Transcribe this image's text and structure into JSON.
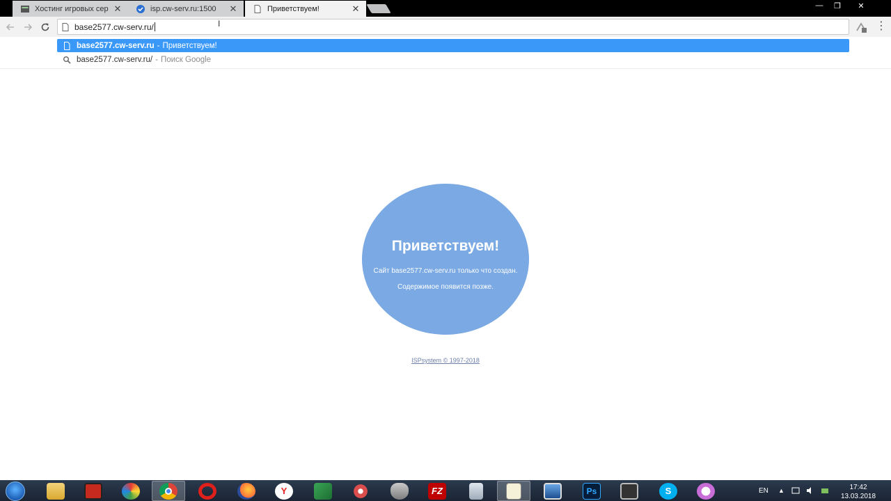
{
  "browser": {
    "tabs": [
      {
        "title": "Хостинг игровых серве",
        "state": "inactive",
        "icon": "server-favicon-icon"
      },
      {
        "title": "isp.cw-serv.ru:1500",
        "state": "inactive",
        "icon": "isp-check-favicon-icon"
      },
      {
        "title": "Приветствуем!",
        "state": "active",
        "icon": "page-icon"
      }
    ],
    "close_glyph": "✕",
    "window_controls": {
      "minimize": "—",
      "maximize": "❐",
      "close": "✕"
    },
    "address_value": "base2577.cw-serv.ru/",
    "suggestions": [
      {
        "url": "base2577.cw-serv.ru",
        "separator": "-",
        "title": "Приветствуем!",
        "icon": "page-icon"
      },
      {
        "url": "base2577.cw-serv.ru/",
        "separator": "-",
        "title": "Поиск Google",
        "icon": "search-icon"
      }
    ],
    "colors": {
      "selection": "#3a98f8",
      "toolbar": "#f2f2f2"
    }
  },
  "page": {
    "title": "Приветствуем!",
    "line1": "Сайт base2577.cw-serv.ru только что создан.",
    "line2": "Содержимое появится позже.",
    "footer": "ISPsystem © 1997-2018",
    "circle_color": "#7aa9e3"
  },
  "taskbar": {
    "apps": [
      {
        "name": "file-explorer",
        "icon": "folder-icon",
        "active": false
      },
      {
        "name": "app-red",
        "icon": "red-app-icon",
        "active": false
      },
      {
        "name": "app-colorful",
        "icon": "colorful-ball-icon",
        "active": false
      },
      {
        "name": "chrome",
        "icon": "chrome-icon",
        "active": true
      },
      {
        "name": "opera",
        "icon": "opera-icon",
        "active": false
      },
      {
        "name": "firefox",
        "icon": "firefox-icon",
        "active": false
      },
      {
        "name": "yandex",
        "icon": "yandex-icon",
        "active": false
      },
      {
        "name": "app-green",
        "icon": "green-app-icon",
        "active": false
      },
      {
        "name": "app-swirl",
        "icon": "swirl-app-icon",
        "active": false
      },
      {
        "name": "app-mask",
        "icon": "mask-app-icon",
        "active": false
      },
      {
        "name": "filezilla",
        "icon": "filezilla-icon",
        "active": false
      },
      {
        "name": "calculator",
        "icon": "calculator-icon",
        "active": false
      },
      {
        "name": "notepad",
        "icon": "notepad-icon",
        "active": false
      },
      {
        "name": "remote-desktop",
        "icon": "remote-desktop-icon",
        "active": false
      },
      {
        "name": "photoshop",
        "icon": "photoshop-icon",
        "active": false
      },
      {
        "name": "video",
        "icon": "film-icon",
        "active": false
      },
      {
        "name": "skype",
        "icon": "skype-icon",
        "active": false
      },
      {
        "name": "itunes",
        "icon": "itunes-icon",
        "active": false
      }
    ],
    "photoshop_label": "Ps",
    "filezilla_label": "FZ",
    "skype_label": "S",
    "yandex_label": "Y",
    "language": "EN",
    "time": "17:42",
    "date": "13.03.2018"
  }
}
